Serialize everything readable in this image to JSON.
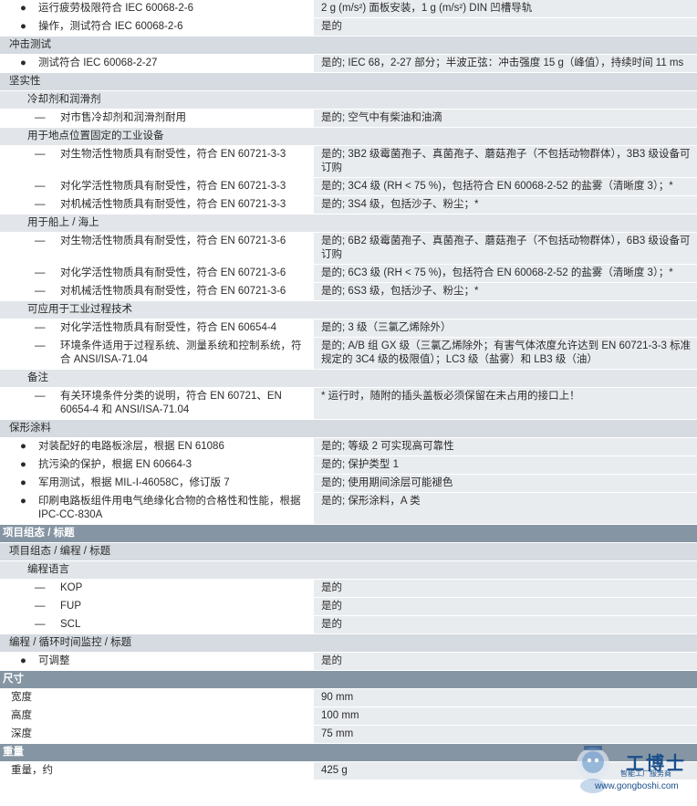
{
  "rows": [
    {
      "kind": "data",
      "style": "bul1",
      "left": "运行疲劳极限符合 IEC 60068-2-6",
      "right": "2 g (m/s²) 面板安装，1 g (m/s²) DIN 凹槽导轨"
    },
    {
      "kind": "data",
      "style": "bul1",
      "left": "操作，测试符合 IEC 60068-2-6",
      "right": "是的"
    },
    {
      "kind": "cat",
      "left": "冲击测试"
    },
    {
      "kind": "data",
      "style": "bul1",
      "left": "测试符合 IEC 60068-2-27",
      "right": "是的; IEC 68，2-27 部分；半波正弦：冲击强度 15 g（峰值），持续时间 11 ms"
    },
    {
      "kind": "cat",
      "left": "坚实性"
    },
    {
      "kind": "sub",
      "left": "冷却剂和润滑剂"
    },
    {
      "kind": "data",
      "style": "dash2",
      "left": "对市售冷却剂和润滑剂耐用",
      "right": "是的; 空气中有柴油和油滴"
    },
    {
      "kind": "sub",
      "left": "用于地点位置固定的工业设备"
    },
    {
      "kind": "data",
      "style": "dash2",
      "left": "对生物活性物质具有耐受性，符合 EN 60721-3-3",
      "right": "是的; 3B2 级霉菌孢子、真菌孢子、蘑菇孢子（不包括动物群体），3B3 级设备可订购"
    },
    {
      "kind": "data",
      "style": "dash2",
      "left": "对化学活性物质具有耐受性，符合 EN 60721-3-3",
      "right": "是的; 3C4 级 (RH < 75 %)，包括符合 EN 60068-2-52 的盐雾（清晰度 3）；*"
    },
    {
      "kind": "data",
      "style": "dash2",
      "left": "对机械活性物质具有耐受性，符合 EN 60721-3-3",
      "right": "是的; 3S4 级，包括沙子、粉尘；*"
    },
    {
      "kind": "sub",
      "left": "用于船上 / 海上"
    },
    {
      "kind": "data",
      "style": "dash2",
      "left": "对生物活性物质具有耐受性，符合 EN 60721-3-6",
      "right": "是的; 6B2 级霉菌孢子、真菌孢子、蘑菇孢子（不包括动物群体），6B3 级设备可订购"
    },
    {
      "kind": "data",
      "style": "dash2",
      "left": "对化学活性物质具有耐受性，符合 EN 60721-3-6",
      "right": "是的; 6C3 级 (RH < 75 %)，包括符合 EN 60068-2-52 的盐雾（清晰度 3）；*"
    },
    {
      "kind": "data",
      "style": "dash2",
      "left": "对机械活性物质具有耐受性，符合 EN 60721-3-6",
      "right": "是的; 6S3 级，包括沙子、粉尘；*"
    },
    {
      "kind": "sub",
      "left": "可应用于工业过程技术"
    },
    {
      "kind": "data",
      "style": "dash2",
      "left": "对化学活性物质具有耐受性，符合 EN 60654-4",
      "right": "是的; 3 级（三氯乙烯除外）"
    },
    {
      "kind": "data",
      "style": "dash2",
      "left": "环境条件适用于过程系统、测量系统和控制系统，符合 ANSI/ISA-71.04",
      "right": "是的; A/B 组 GX 级（三氯乙烯除外；有害气体浓度允许达到 EN 60721-3-3 标准规定的 3C4 级的极限值）；LC3 级（盐雾）和 LB3 级（油）"
    },
    {
      "kind": "sub",
      "left": "备注"
    },
    {
      "kind": "data",
      "style": "dash2",
      "left": "有关环境条件分类的说明，符合 EN 60721、EN 60654-4 和 ANSI/ISA-71.04",
      "right": "* 运行时，随附的插头盖板必须保留在未占用的接口上！"
    },
    {
      "kind": "cat",
      "left": "保形涂料"
    },
    {
      "kind": "data",
      "style": "bul1",
      "left": "对装配好的电路板涂层，根据 EN 61086",
      "right": "是的; 等级 2 可实现高可靠性"
    },
    {
      "kind": "data",
      "style": "bul1",
      "left": "抗污染的保护，根据 EN 60664-3",
      "right": "是的; 保护类型 1"
    },
    {
      "kind": "data",
      "style": "bul1",
      "left": "军用测试，根据 MIL-I-46058C，修订版 7",
      "right": "是的; 使用期间涂层可能褪色"
    },
    {
      "kind": "data",
      "style": "bul1",
      "left": "印刷电路板组件用电气绝缘化合物的合格性和性能，根据 IPC-CC-830A",
      "right": "是的; 保形涂料，A 类"
    },
    {
      "kind": "sect",
      "left": "项目组态 / 标题"
    },
    {
      "kind": "cat",
      "left": "项目组态 / 编程 / 标题"
    },
    {
      "kind": "sub",
      "left": "编程语言"
    },
    {
      "kind": "data",
      "style": "dash2",
      "left": "KOP",
      "right": "是的"
    },
    {
      "kind": "data",
      "style": "dash2",
      "left": "FUP",
      "right": "是的"
    },
    {
      "kind": "data",
      "style": "dash2",
      "left": "SCL",
      "right": "是的"
    },
    {
      "kind": "cat",
      "left": "编程 / 循环时间监控 / 标题"
    },
    {
      "kind": "data",
      "style": "bul1",
      "left": "可调整",
      "right": "是的"
    },
    {
      "kind": "sect",
      "left": "尺寸"
    },
    {
      "kind": "data",
      "style": "plain",
      "left": "宽度",
      "right": "90 mm"
    },
    {
      "kind": "data",
      "style": "plain",
      "left": "高度",
      "right": "100 mm"
    },
    {
      "kind": "data",
      "style": "plain",
      "left": "深度",
      "right": "75 mm"
    },
    {
      "kind": "sect",
      "left": "重量"
    },
    {
      "kind": "data",
      "style": "plain",
      "left": "重量，约",
      "right": "425 g"
    }
  ],
  "symbols": {
    "bullet": "●",
    "dash": "—"
  },
  "watermark": {
    "name": "工博士",
    "sub": "智能工厂服务商",
    "url": "www.gongboshi.com"
  }
}
